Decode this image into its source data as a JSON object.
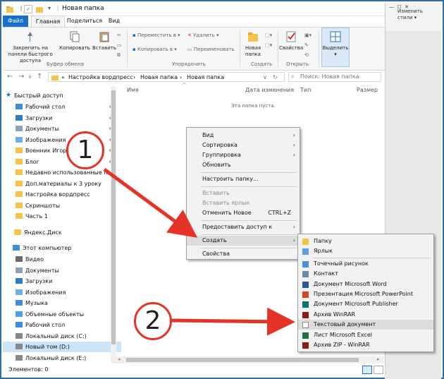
{
  "window": {
    "title": "Новая папка"
  },
  "tabs": [
    "Файл",
    "Главная",
    "Поделиться",
    "Вид"
  ],
  "ribbon": {
    "pin_label": "Закрепить на панели быстрого доступа",
    "copy_label": "Копировать",
    "paste_label": "Вставить",
    "clipboard_group": "Буфер обмена",
    "move_to": "Переместить в ▾",
    "copy_to": "Копировать в ▾",
    "delete": "Удалить ▾",
    "rename": "Переименовать",
    "organize_group": "Упорядочить",
    "new_folder": "Новая папка",
    "create_group": "Создать",
    "properties": "Свойства",
    "open_group": "Открыть",
    "select": "Выделить"
  },
  "word_strip": {
    "styles_label": "Изменить стили ▾"
  },
  "address": {
    "crumbs": [
      "«",
      "Настройка вордпресс",
      "›",
      "Новая папка",
      "›",
      "Новая папка"
    ],
    "search_placeholder": "Поиск: Новая папка"
  },
  "nav": {
    "quick_access": "Быстрый доступ",
    "items": [
      "Рабочий стол",
      "Загрузки",
      "Документы",
      "Изображения",
      "Военник Игорь",
      "Блог",
      "Недавно использованные пап",
      "Доп.материалы к 3 уроку",
      "Настройка вордпресс",
      "Скриншоты",
      "Часть 1"
    ],
    "yandex": "Яндекс.Диск",
    "this_pc": "Этот компьютер",
    "pc_items": [
      "Видео",
      "Документы",
      "Загрузки",
      "Изображения",
      "Музыка",
      "Объемные объекты",
      "Рабочий стол",
      "Локальный диск (C:)",
      "Новый том (D:)",
      "Локальный диск (E:)"
    ]
  },
  "columns": {
    "name": "Имя",
    "date": "Дата изменения",
    "type": "Тип",
    "size": "Размер"
  },
  "empty_text": "Эта папка пуста.",
  "status": {
    "items": "Элементов: 0"
  },
  "context_menu": {
    "view": "Вид",
    "sort": "Сортировка",
    "group": "Группировка",
    "refresh": "Обновить",
    "customize": "Настроить папку...",
    "paste": "Вставить",
    "paste_shortcut": "Вставить ярлык",
    "undo": "Отменить Новое",
    "undo_key": "CTRL+Z",
    "share": "Предоставить доступ к",
    "create": "Создать",
    "properties": "Свойства"
  },
  "submenu": {
    "items": [
      "Папку",
      "Ярлык",
      "Точечный рисунок",
      "Контакт",
      "Документ Microsoft Word",
      "Презентация Microsoft PowerPoint",
      "Документ Microsoft Publisher",
      "Архив WinRAR",
      "Текстовый документ",
      "Лист Microsoft Excel",
      "Архив ZIP - WinRAR"
    ]
  },
  "annotations": {
    "one": "1",
    "two": "2"
  },
  "colors": {
    "accent": "#1a6fc6",
    "arrow": "#e53327",
    "folder": "#f3c44b"
  }
}
